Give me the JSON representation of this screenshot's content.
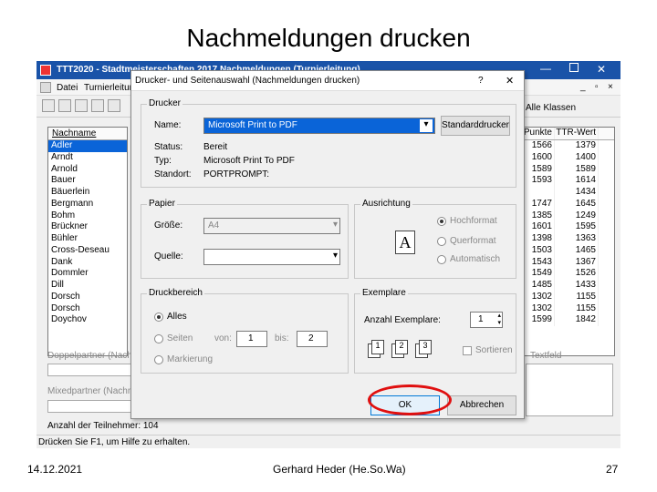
{
  "slide": {
    "title": "Nachmeldungen drucken",
    "date": "14.12.2021",
    "author": "Gerhard Heder (He.So.Wa)",
    "page": "27"
  },
  "main_window": {
    "title": "TTT2020 - Stadtmeisterschaften 2017 Nachmeldungen (Turnierleitung)",
    "menu": [
      "Datei",
      "Turnierleitung"
    ],
    "right_label": "Alle Klassen",
    "status_text": "Drücken Sie F1, um Hilfe zu erhalten.",
    "participants": "Anzahl der Teilnehmer: 104",
    "doppelpartner": "Doppelpartner (Nachmeldungen)",
    "mixedpartner": "Mixedpartner (Nachmeldungen)",
    "textfeld": "Textfeld",
    "name_header": "Nachname",
    "names": [
      "Adler",
      "Arndt",
      "Arnold",
      "Bauer",
      "Bäuerlein",
      "Bergmann",
      "Bohm",
      "Brückner",
      "Bühler",
      "Cross-Deseau",
      "Dank",
      "Dommler",
      "Dill",
      "Dorsch",
      "Dorsch",
      "Doychov"
    ],
    "grid_headers": [
      "Punkte",
      "TTR-Wert"
    ],
    "grid_rows": [
      [
        "1566",
        "1379"
      ],
      [
        "1600",
        "1400"
      ],
      [
        "1589",
        "1589"
      ],
      [
        "1593",
        "1614"
      ],
      [
        "",
        "1434"
      ],
      [
        "1747",
        "1645"
      ],
      [
        "1385",
        "1249"
      ],
      [
        "1601",
        "1595"
      ],
      [
        "1398",
        "1363"
      ],
      [
        "1503",
        "1465"
      ],
      [
        "1543",
        "1367"
      ],
      [
        "1549",
        "1526"
      ],
      [
        "1485",
        "1433"
      ],
      [
        "1302",
        "1155"
      ],
      [
        "1302",
        "1155"
      ],
      [
        "1599",
        "1842"
      ]
    ]
  },
  "dialog": {
    "title": "Drucker- und Seitenauswahl (Nachmeldungen drucken)",
    "help_btn": "?",
    "close_btn": "✕",
    "printer": {
      "group": "Drucker",
      "name_label": "Name:",
      "name_value": "Microsoft Print to PDF",
      "default_btn": "Standarddrucker",
      "status_label": "Status:",
      "status_value": "Bereit",
      "type_label": "Typ:",
      "type_value": "Microsoft Print To PDF",
      "location_label": "Standort:",
      "location_value": "PORTPROMPT:"
    },
    "paper": {
      "group": "Papier",
      "size_label": "Größe:",
      "size_value": "A4",
      "source_label": "Quelle:",
      "source_value": ""
    },
    "orientation": {
      "group": "Ausrichtung",
      "options": [
        "Hochformat",
        "Querformat",
        "Automatisch"
      ],
      "selected": "Hochformat"
    },
    "range": {
      "group": "Druckbereich",
      "all": "Alles",
      "pages": "Seiten",
      "from_label": "von:",
      "from_value": "1",
      "to_label": "bis:",
      "to_value": "2",
      "selection": "Markierung"
    },
    "copies": {
      "group": "Exemplare",
      "count_label": "Anzahl Exemplare:",
      "count_value": "1",
      "collate": "Sortieren"
    },
    "ok": "OK",
    "cancel": "Abbrechen"
  }
}
